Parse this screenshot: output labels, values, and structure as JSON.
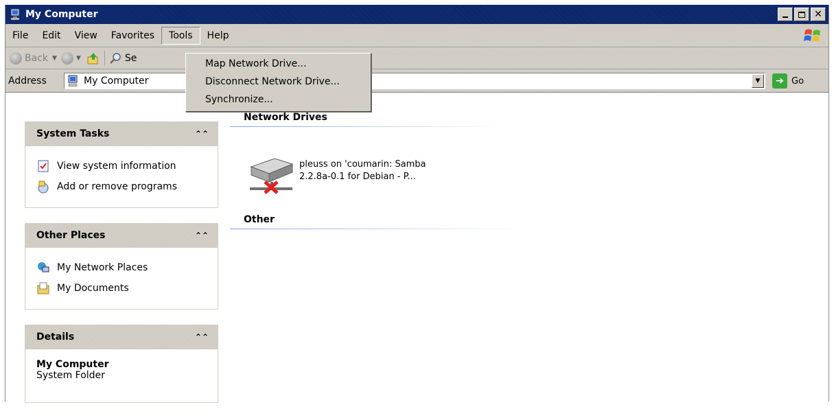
{
  "window": {
    "title": "My Computer"
  },
  "menubar": {
    "items": [
      "File",
      "Edit",
      "View",
      "Favorites",
      "Tools",
      "Help"
    ]
  },
  "toolbar": {
    "back_label": "Back",
    "search_label": "Se"
  },
  "address": {
    "label": "Address",
    "value": "My Computer",
    "go_label": "Go"
  },
  "tools_menu": {
    "items": [
      "Map Network Drive...",
      "Disconnect Network Drive...",
      "Synchronize..."
    ]
  },
  "panels": {
    "system_tasks": {
      "title": "System Tasks",
      "items": [
        "View system information",
        "Add or remove programs"
      ]
    },
    "other_places": {
      "title": "Other Places",
      "items": [
        "My Network Places",
        "My Documents"
      ]
    },
    "details": {
      "title": "Details",
      "name": "My Computer",
      "type": "System Folder"
    }
  },
  "content": {
    "network_drives_header": "Network Drives",
    "drive_label_line1": "pleuss on 'coumarin: Samba",
    "drive_label_line2": "2.2.8a-0.1 for Debian - P...",
    "other_header": "Other"
  }
}
